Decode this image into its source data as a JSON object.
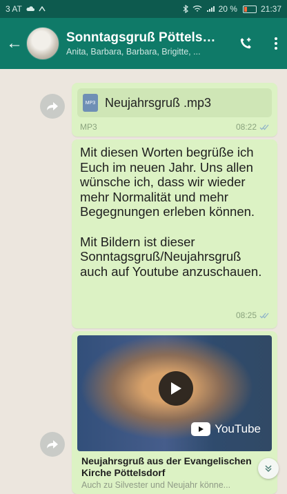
{
  "status_bar": {
    "left_text": "3 AT",
    "battery_percent": "20 %",
    "time": "21:37"
  },
  "header": {
    "title": "Sonntagsgruß Pöttelsd...",
    "subtitle": "Anita, Barbara, Barbara, Brigitte, ...",
    "icons": [
      "back-arrow-icon",
      "add-call-icon",
      "more-vert-icon"
    ]
  },
  "messages": {
    "audio": {
      "file_name": "Neujahrsgruß .mp3",
      "file_type": "MP3",
      "time": "08:22"
    },
    "text": {
      "paragraph_1": "Mit diesen Worten begrüße ich Euch im neuen Jahr. Uns allen wünsche ich, dass wir wieder mehr Normalität und mehr Begegnungen erleben können.",
      "paragraph_2": "Mit Bildern ist dieser Sonntagsgruß/Neujahrsgruß auch auf Youtube anzuschauen.",
      "time": "08:25"
    },
    "video": {
      "brand": "YouTube",
      "title": "Neujahrsgruß aus der Evangelischen Kirche Pöttelsdorf",
      "subtitle": "Auch zu Silvester und Neujahr könne..."
    }
  },
  "colors": {
    "header_bg": "#0f7a68",
    "bubble_bg": "#dcf2c4",
    "chat_bg": "#ece6de"
  }
}
